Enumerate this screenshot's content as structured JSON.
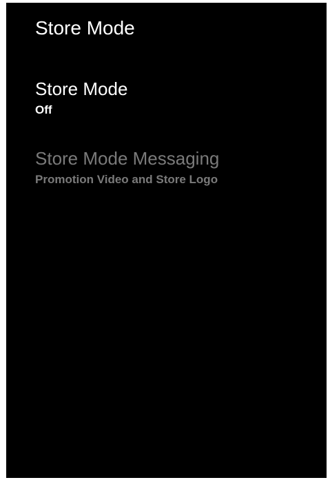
{
  "page": {
    "title": "Store Mode"
  },
  "menu": {
    "items": [
      {
        "title": "Store Mode",
        "subtitle": "Off",
        "enabled": true
      },
      {
        "title": "Store Mode Messaging",
        "subtitle": "Promotion Video and Store Logo",
        "enabled": false
      }
    ]
  },
  "colors": {
    "background": "#000000",
    "text_primary": "#ffffff",
    "text_disabled": "#7a7a7a"
  }
}
